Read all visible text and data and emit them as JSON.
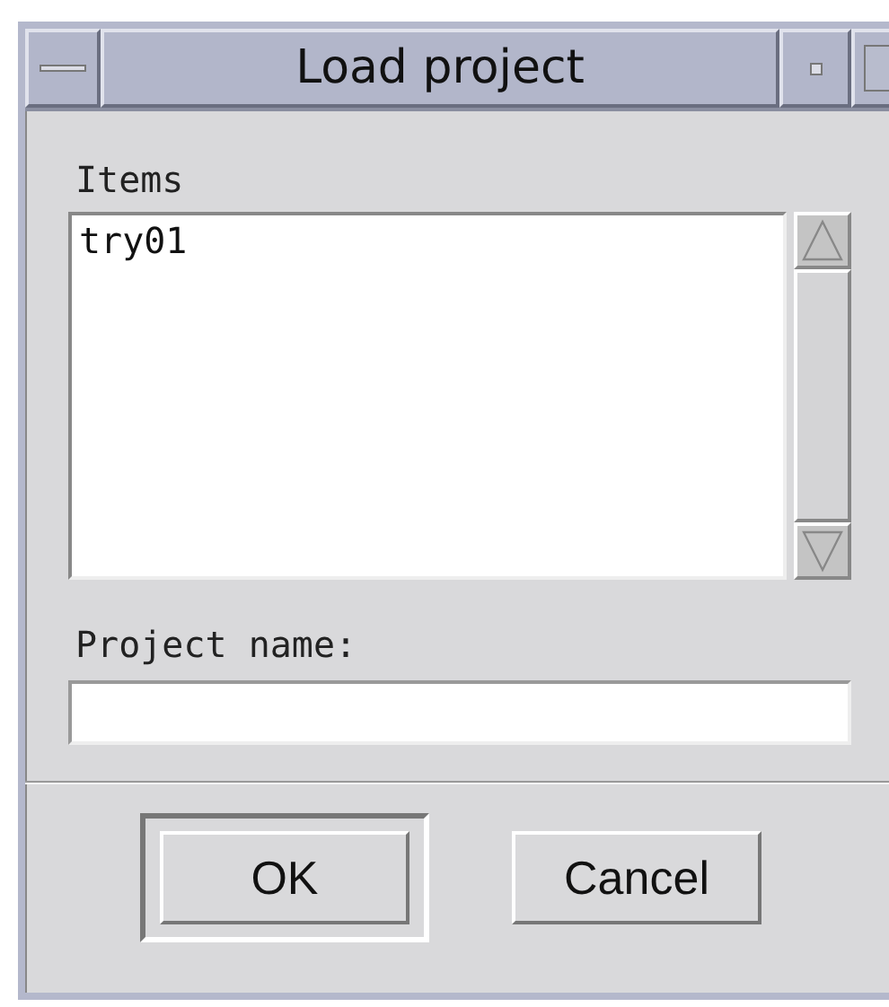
{
  "window": {
    "title": "Load project"
  },
  "items_label": "Items",
  "items": [
    {
      "label": "try01",
      "selected": false
    }
  ],
  "name_label": "Project name:",
  "buttons": [
    {
      "label": "OK",
      "default": true
    },
    {
      "label": "Cancel",
      "default": false
    }
  ]
}
